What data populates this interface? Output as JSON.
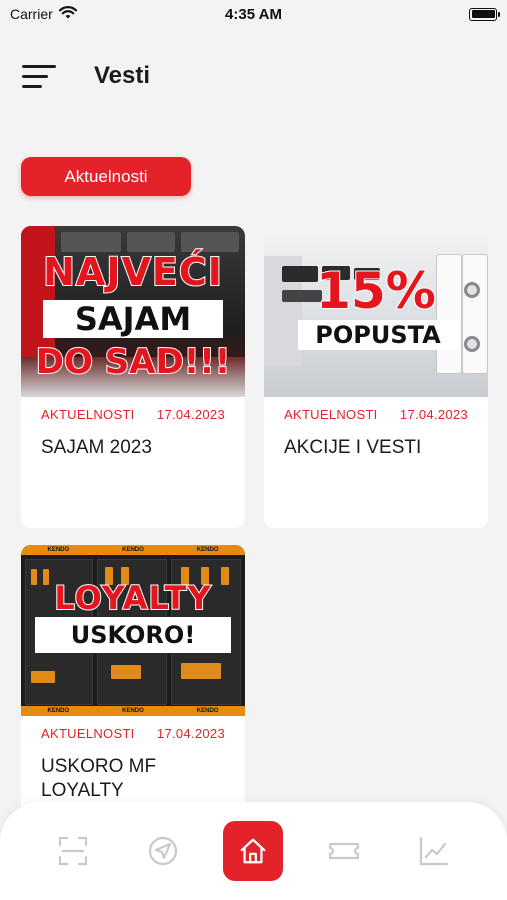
{
  "status_bar": {
    "carrier": "Carrier",
    "time": "4:35 AM",
    "battery_level": 1.0
  },
  "header": {
    "title": "Vesti",
    "menu_icon": "hamburger-menu-icon"
  },
  "category_chip": {
    "label": "Aktuelnosti"
  },
  "cards": [
    {
      "category": "AKTUELNOSTI",
      "date": "17.04.2023",
      "title": "SAJAM 2023",
      "image_text": [
        "NAJVEĆI",
        "SAJAM",
        "DO SAD!!!"
      ]
    },
    {
      "category": "AKTUELNOSTI",
      "date": "17.04.2023",
      "title": "AKCIJE I VESTI",
      "image_text": [
        "15%",
        "POPUSTA"
      ]
    },
    {
      "category": "AKTUELNOSTI",
      "date": "17.04.2023",
      "title": "USKORO MF LOYALTY",
      "image_text": [
        "LOYALTY",
        "USKORO!",
        "KENDO"
      ]
    }
  ],
  "bottom_nav": {
    "items": [
      {
        "icon": "scan-icon",
        "active": false
      },
      {
        "icon": "compass-icon",
        "active": false
      },
      {
        "icon": "home-icon",
        "active": true
      },
      {
        "icon": "ticket-icon",
        "active": false
      },
      {
        "icon": "chart-icon",
        "active": false
      }
    ]
  },
  "colors": {
    "accent": "#e42229",
    "background": "#f3f3f3",
    "inactive_icon": "#c9c9c9"
  }
}
